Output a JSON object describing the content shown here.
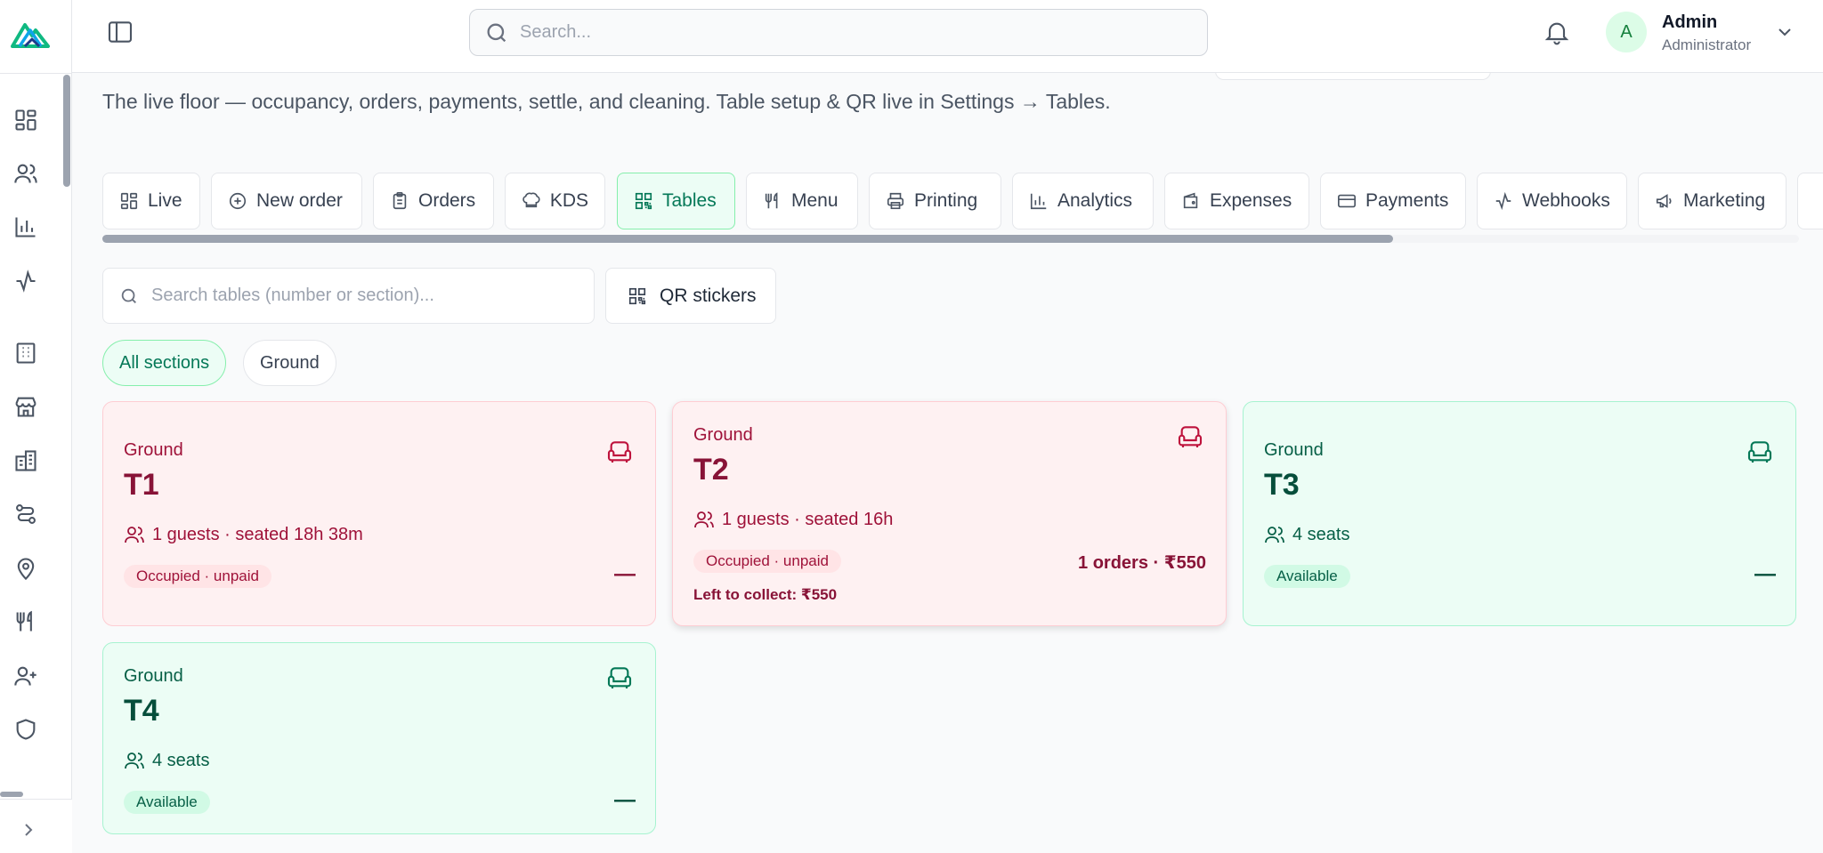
{
  "header": {
    "search_placeholder": "Search...",
    "user": {
      "initial": "A",
      "name": "Admin",
      "role": "Administrator"
    }
  },
  "page": {
    "description": "The live floor — occupancy, orders, payments, settle, and cleaning. Table setup & QR live in Settings → Tables."
  },
  "tabs": [
    {
      "label": "Live",
      "icon": "grid-icon",
      "active": false
    },
    {
      "label": "New order",
      "icon": "plus-circle-icon",
      "active": false
    },
    {
      "label": "Orders",
      "icon": "clipboard-icon",
      "active": false
    },
    {
      "label": "KDS",
      "icon": "chef-hat-icon",
      "active": false
    },
    {
      "label": "Tables",
      "icon": "qr-icon",
      "active": true
    },
    {
      "label": "Menu",
      "icon": "utensils-icon",
      "active": false
    },
    {
      "label": "Printing",
      "icon": "printer-icon",
      "active": false
    },
    {
      "label": "Analytics",
      "icon": "bar-chart-icon",
      "active": false
    },
    {
      "label": "Expenses",
      "icon": "wallet-icon",
      "active": false
    },
    {
      "label": "Payments",
      "icon": "credit-card-icon",
      "active": false
    },
    {
      "label": "Webhooks",
      "icon": "activity-icon",
      "active": false
    },
    {
      "label": "Marketing",
      "icon": "megaphone-icon",
      "active": false
    }
  ],
  "toolbar": {
    "search_placeholder": "Search tables (number or section)...",
    "qr_label": "QR stickers"
  },
  "filters": [
    {
      "label": "All sections",
      "active": true
    },
    {
      "label": "Ground",
      "active": false
    }
  ],
  "tables": [
    {
      "section": "Ground",
      "number": "T1",
      "guests": "1 guests ·  seated 18h 38m",
      "status": "Occupied · unpaid",
      "status_type": "occupied",
      "right": "—"
    },
    {
      "section": "Ground",
      "number": "T2",
      "guests": "1 guests ·  seated 16h",
      "status": "Occupied · unpaid",
      "status_type": "occupied",
      "right": "1 orders · ₹550",
      "collect": "Left to collect: ₹550"
    },
    {
      "section": "Ground",
      "number": "T3",
      "guests": "4 seats",
      "status": "Available",
      "status_type": "available",
      "right": "—"
    },
    {
      "section": "Ground",
      "number": "T4",
      "guests": "4 seats",
      "status": "Available",
      "status_type": "available",
      "right": "—"
    }
  ],
  "colors": {
    "accent": "#047857",
    "occupied_bg": "#fef1f2",
    "available_bg": "#ecfdf5"
  }
}
